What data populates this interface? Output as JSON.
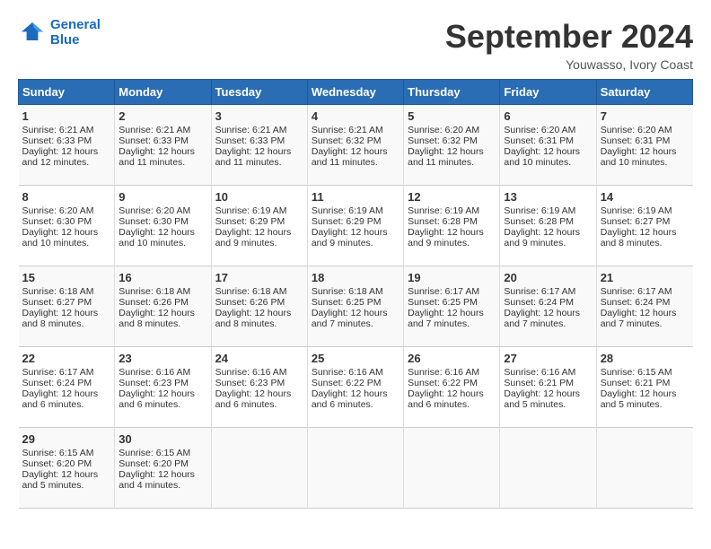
{
  "header": {
    "logo_line1": "General",
    "logo_line2": "Blue",
    "month": "September 2024",
    "location": "Youwasso, Ivory Coast"
  },
  "days_of_week": [
    "Sunday",
    "Monday",
    "Tuesday",
    "Wednesday",
    "Thursday",
    "Friday",
    "Saturday"
  ],
  "weeks": [
    [
      {
        "day": "1",
        "sunrise": "6:21 AM",
        "sunset": "6:33 PM",
        "daylight": "12 hours and 12 minutes."
      },
      {
        "day": "2",
        "sunrise": "6:21 AM",
        "sunset": "6:33 PM",
        "daylight": "12 hours and 11 minutes."
      },
      {
        "day": "3",
        "sunrise": "6:21 AM",
        "sunset": "6:33 PM",
        "daylight": "12 hours and 11 minutes."
      },
      {
        "day": "4",
        "sunrise": "6:21 AM",
        "sunset": "6:32 PM",
        "daylight": "12 hours and 11 minutes."
      },
      {
        "day": "5",
        "sunrise": "6:20 AM",
        "sunset": "6:32 PM",
        "daylight": "12 hours and 11 minutes."
      },
      {
        "day": "6",
        "sunrise": "6:20 AM",
        "sunset": "6:31 PM",
        "daylight": "12 hours and 10 minutes."
      },
      {
        "day": "7",
        "sunrise": "6:20 AM",
        "sunset": "6:31 PM",
        "daylight": "12 hours and 10 minutes."
      }
    ],
    [
      {
        "day": "8",
        "sunrise": "6:20 AM",
        "sunset": "6:30 PM",
        "daylight": "12 hours and 10 minutes."
      },
      {
        "day": "9",
        "sunrise": "6:20 AM",
        "sunset": "6:30 PM",
        "daylight": "12 hours and 10 minutes."
      },
      {
        "day": "10",
        "sunrise": "6:19 AM",
        "sunset": "6:29 PM",
        "daylight": "12 hours and 9 minutes."
      },
      {
        "day": "11",
        "sunrise": "6:19 AM",
        "sunset": "6:29 PM",
        "daylight": "12 hours and 9 minutes."
      },
      {
        "day": "12",
        "sunrise": "6:19 AM",
        "sunset": "6:28 PM",
        "daylight": "12 hours and 9 minutes."
      },
      {
        "day": "13",
        "sunrise": "6:19 AM",
        "sunset": "6:28 PM",
        "daylight": "12 hours and 9 minutes."
      },
      {
        "day": "14",
        "sunrise": "6:19 AM",
        "sunset": "6:27 PM",
        "daylight": "12 hours and 8 minutes."
      }
    ],
    [
      {
        "day": "15",
        "sunrise": "6:18 AM",
        "sunset": "6:27 PM",
        "daylight": "12 hours and 8 minutes."
      },
      {
        "day": "16",
        "sunrise": "6:18 AM",
        "sunset": "6:26 PM",
        "daylight": "12 hours and 8 minutes."
      },
      {
        "day": "17",
        "sunrise": "6:18 AM",
        "sunset": "6:26 PM",
        "daylight": "12 hours and 8 minutes."
      },
      {
        "day": "18",
        "sunrise": "6:18 AM",
        "sunset": "6:25 PM",
        "daylight": "12 hours and 7 minutes."
      },
      {
        "day": "19",
        "sunrise": "6:17 AM",
        "sunset": "6:25 PM",
        "daylight": "12 hours and 7 minutes."
      },
      {
        "day": "20",
        "sunrise": "6:17 AM",
        "sunset": "6:24 PM",
        "daylight": "12 hours and 7 minutes."
      },
      {
        "day": "21",
        "sunrise": "6:17 AM",
        "sunset": "6:24 PM",
        "daylight": "12 hours and 7 minutes."
      }
    ],
    [
      {
        "day": "22",
        "sunrise": "6:17 AM",
        "sunset": "6:24 PM",
        "daylight": "12 hours and 6 minutes."
      },
      {
        "day": "23",
        "sunrise": "6:16 AM",
        "sunset": "6:23 PM",
        "daylight": "12 hours and 6 minutes."
      },
      {
        "day": "24",
        "sunrise": "6:16 AM",
        "sunset": "6:23 PM",
        "daylight": "12 hours and 6 minutes."
      },
      {
        "day": "25",
        "sunrise": "6:16 AM",
        "sunset": "6:22 PM",
        "daylight": "12 hours and 6 minutes."
      },
      {
        "day": "26",
        "sunrise": "6:16 AM",
        "sunset": "6:22 PM",
        "daylight": "12 hours and 6 minutes."
      },
      {
        "day": "27",
        "sunrise": "6:16 AM",
        "sunset": "6:21 PM",
        "daylight": "12 hours and 5 minutes."
      },
      {
        "day": "28",
        "sunrise": "6:15 AM",
        "sunset": "6:21 PM",
        "daylight": "12 hours and 5 minutes."
      }
    ],
    [
      {
        "day": "29",
        "sunrise": "6:15 AM",
        "sunset": "6:20 PM",
        "daylight": "12 hours and 5 minutes."
      },
      {
        "day": "30",
        "sunrise": "6:15 AM",
        "sunset": "6:20 PM",
        "daylight": "12 hours and 4 minutes."
      },
      null,
      null,
      null,
      null,
      null
    ]
  ]
}
